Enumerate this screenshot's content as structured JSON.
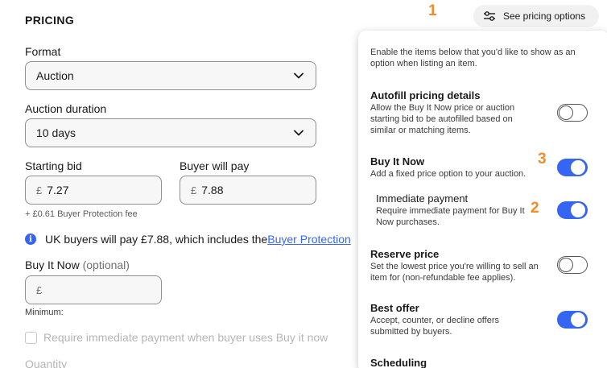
{
  "pricing": {
    "heading": "PRICING",
    "format_label": "Format",
    "format_value": "Auction",
    "duration_label": "Auction duration",
    "duration_value": "10 days",
    "starting_bid_label": "Starting bid",
    "starting_bid_currency": "£",
    "starting_bid_value": "7.27",
    "buyer_pays_label": "Buyer will pay",
    "buyer_pays_currency": "£",
    "buyer_pays_value": "7.88",
    "protection_fee": "+ £0.61 Buyer Protection fee",
    "info_text": "UK buyers will pay £7.88, which includes the ",
    "info_link": "Buyer Protection",
    "bin_label": "Buy It Now",
    "bin_optional": "(optional)",
    "bin_currency": "£",
    "bin_value": "",
    "minimum_label": "Minimum:",
    "require_payment_checkbox": "Require immediate payment when buyer uses Buy it now",
    "require_payment_checked": false,
    "quantity_label": "Quantity"
  },
  "options_button": {
    "label": "See pricing options",
    "icon": "sliders-icon"
  },
  "panel": {
    "intro": "Enable the items below that you'd like to show as an option when listing an item.",
    "options": [
      {
        "title": "Autofill pricing details",
        "desc": "Allow the Buy It Now price or auction starting bid to be autofilled based on similar or matching items.",
        "enabled": false
      },
      {
        "title": "Buy It Now",
        "desc": "Add a fixed price option to your auction.",
        "enabled": true
      },
      {
        "title": "Immediate payment",
        "desc": "Require immediate payment for Buy It Now purchases.",
        "enabled": true
      },
      {
        "title": "Reserve price",
        "desc": "Set the lowest price you're willing to sell an item for (non-refundable fee applies).",
        "enabled": false
      },
      {
        "title": "Best offer",
        "desc": "Accept, counter, or decline offers submitted by buyers.",
        "enabled": true
      },
      {
        "title": "Scheduling",
        "desc": "",
        "enabled": false
      }
    ]
  },
  "annotations": [
    "1",
    "2",
    "3"
  ],
  "colors": {
    "accent": "#3665f3",
    "annotation": "#f28c28"
  }
}
